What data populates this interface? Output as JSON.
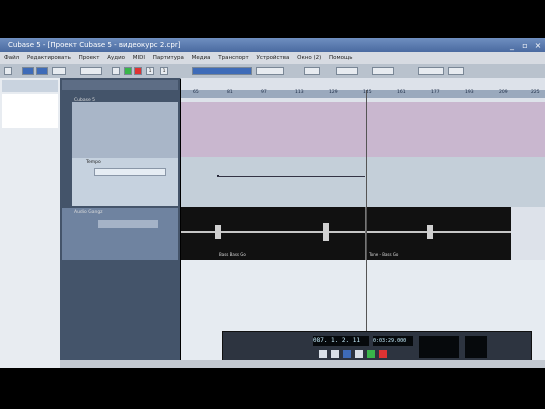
{
  "window": {
    "title": "Cubase 5 - [Проект Cubase 5 - видеокурс 2.cpr]"
  },
  "menu": [
    "Файл",
    "Редактировать",
    "Проект",
    "Аудио",
    "MIDI",
    "Партитура",
    "Медиа",
    "Транспорт",
    "Устройства",
    "Окно (2)",
    "Помощь"
  ],
  "toolbar": {
    "counter_a": "1",
    "counter_b": "1"
  },
  "tracks": {
    "header1": "Cubase 5",
    "track2_label": "Tempo",
    "audio_label": "Audio Gangz"
  },
  "ruler": {
    "ticks": [
      "65",
      "81",
      "97",
      "113",
      "129",
      "145",
      "161",
      "177",
      "193",
      "209",
      "225"
    ]
  },
  "audio": {
    "event1": "Bass Bass Go",
    "event2": "Tone - Bass Go"
  },
  "transport": {
    "position": "087. 1. 2. 11",
    "time": "0:03:29.000"
  },
  "colors": {
    "titlebar": "#4a6aa0",
    "lane_purple": "#c9b7cf",
    "lane_gray": "#c4cfd9",
    "audio_bg": "#111111"
  }
}
